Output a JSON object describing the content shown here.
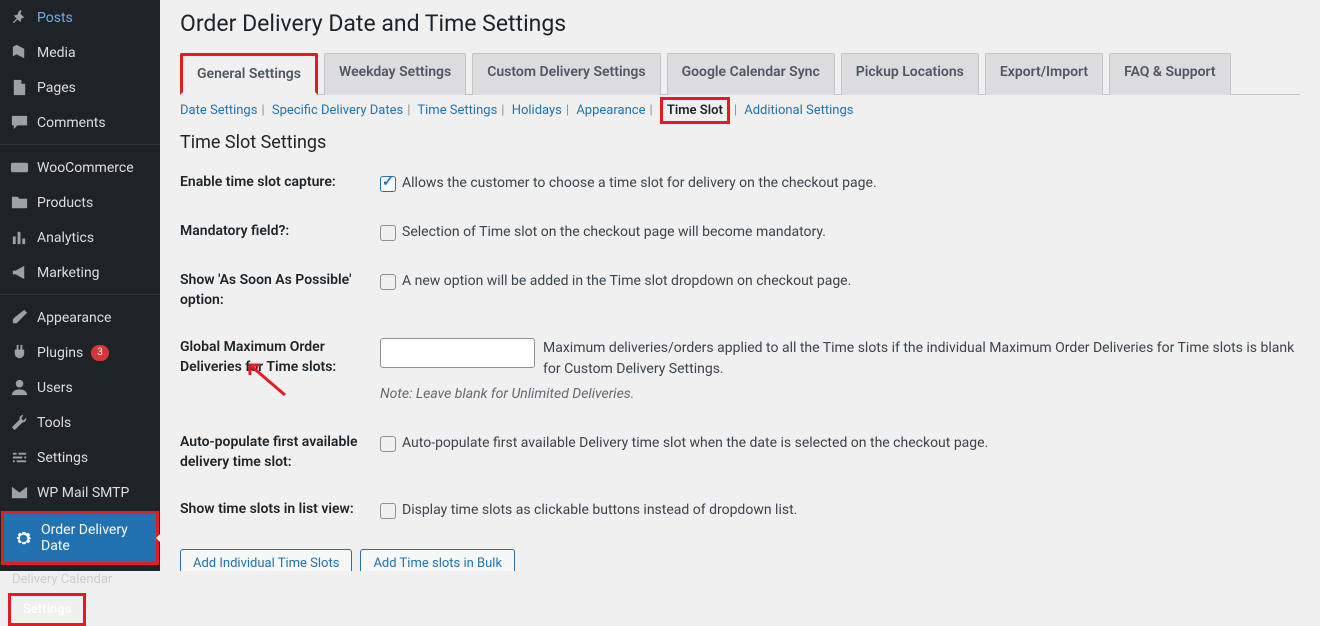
{
  "sidebar": {
    "items": [
      {
        "label": "Posts",
        "icon": "pushpin"
      },
      {
        "label": "Media",
        "icon": "media"
      },
      {
        "label": "Pages",
        "icon": "page"
      },
      {
        "label": "Comments",
        "icon": "comment"
      },
      {
        "label": "WooCommerce",
        "icon": "woo"
      },
      {
        "label": "Products",
        "icon": "folder"
      },
      {
        "label": "Analytics",
        "icon": "chart"
      },
      {
        "label": "Marketing",
        "icon": "megaphone"
      },
      {
        "label": "Appearance",
        "icon": "brush"
      },
      {
        "label": "Plugins",
        "icon": "plug",
        "badge": "3"
      },
      {
        "label": "Users",
        "icon": "user"
      },
      {
        "label": "Tools",
        "icon": "wrench"
      },
      {
        "label": "Settings",
        "icon": "sliders"
      },
      {
        "label": "WP Mail SMTP",
        "icon": "mail"
      },
      {
        "label": "Order Delivery Date",
        "icon": "gear",
        "active": true
      }
    ],
    "submenu": [
      {
        "label": "Delivery Calendar"
      },
      {
        "label": "Settings",
        "selected": true
      }
    ]
  },
  "page_title": "Order Delivery Date and Time Settings",
  "tabs": [
    {
      "label": "General Settings",
      "active": true,
      "highlight": true
    },
    {
      "label": "Weekday Settings"
    },
    {
      "label": "Custom Delivery Settings"
    },
    {
      "label": "Google Calendar Sync"
    },
    {
      "label": "Pickup Locations"
    },
    {
      "label": "Export/Import"
    },
    {
      "label": "FAQ & Support"
    }
  ],
  "subtabs": [
    {
      "label": "Date Settings"
    },
    {
      "label": "Specific Delivery Dates"
    },
    {
      "label": "Time Settings"
    },
    {
      "label": "Holidays"
    },
    {
      "label": "Appearance"
    },
    {
      "label": "Time Slot",
      "selected": true,
      "highlight": true
    },
    {
      "label": "Additional Settings"
    }
  ],
  "section_title": "Time Slot Settings",
  "settings": {
    "enable_capture": {
      "label": "Enable time slot capture:",
      "checked": true,
      "desc": "Allows the customer to choose a time slot for delivery on the checkout page."
    },
    "mandatory": {
      "label": "Mandatory field?:",
      "checked": false,
      "desc": "Selection of Time slot on the checkout page will become mandatory."
    },
    "asap": {
      "label": "Show 'As Soon As Possible' option:",
      "checked": false,
      "desc": "A new option will be added in the Time slot dropdown on checkout page."
    },
    "global_max": {
      "label": "Global Maximum Order Deliveries for Time slots:",
      "value": "",
      "desc": "Maximum deliveries/orders applied to all the Time slots if the individual Maximum Order Deliveries for Time slots is blank for Custom Delivery Settings.",
      "note": "Note: Leave blank for Unlimited Deliveries."
    },
    "auto_populate": {
      "label": "Auto-populate first available delivery time slot:",
      "checked": false,
      "desc": "Auto-populate first available Delivery time slot when the date is selected on the checkout page."
    },
    "list_view": {
      "label": "Show time slots in list view:",
      "checked": false,
      "desc": "Display time slots as clickable buttons instead of dropdown list."
    }
  },
  "buttons": {
    "add_individual": "Add Individual Time Slots",
    "add_bulk": "Add Time slots in Bulk"
  }
}
